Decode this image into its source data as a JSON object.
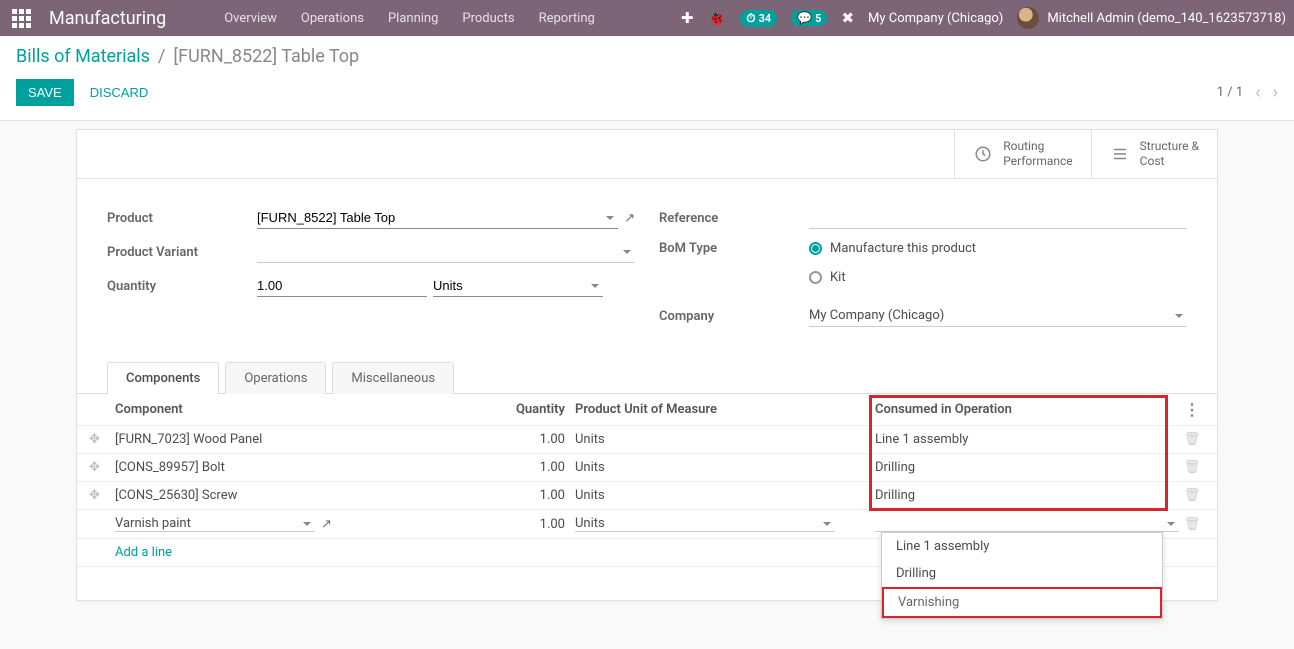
{
  "header": {
    "app": "Manufacturing",
    "nav": [
      "Overview",
      "Operations",
      "Planning",
      "Products",
      "Reporting"
    ],
    "activity_count": "34",
    "msg_count": "5",
    "company": "My Company (Chicago)",
    "user": "Mitchell Admin (demo_140_1623573718)"
  },
  "breadcrumb": {
    "parent": "Bills of Materials",
    "sep": "/",
    "current": "[FURN_8522] Table Top"
  },
  "actions": {
    "save": "SAVE",
    "discard": "DISCARD",
    "pager": "1 / 1"
  },
  "statbuttons": {
    "routing_l1": "Routing",
    "routing_l2": "Performance",
    "struct_l1": "Structure &",
    "struct_l2": "Cost"
  },
  "form": {
    "labels": {
      "product": "Product",
      "variant": "Product Variant",
      "quantity": "Quantity",
      "reference": "Reference",
      "bom_type": "BoM Type",
      "company": "Company"
    },
    "values": {
      "product": "[FURN_8522] Table Top",
      "quantity": "1.00",
      "uom": "Units",
      "bom_type_manufacture": "Manufacture this product",
      "bom_type_kit": "Kit",
      "company": "My Company (Chicago)"
    }
  },
  "tabs": {
    "components": "Components",
    "operations": "Operations",
    "misc": "Miscellaneous"
  },
  "grid": {
    "headers": {
      "component": "Component",
      "quantity": "Quantity",
      "uom": "Product Unit of Measure",
      "consumed": "Consumed in Operation"
    },
    "rows": [
      {
        "name": "[FURN_7023] Wood Panel",
        "qty": "1.00",
        "uom": "Units",
        "consumed": "Line 1 assembly"
      },
      {
        "name": "[CONS_89957] Bolt",
        "qty": "1.00",
        "uom": "Units",
        "consumed": "Drilling"
      },
      {
        "name": "[CONS_25630] Screw",
        "qty": "1.00",
        "uom": "Units",
        "consumed": "Drilling"
      }
    ],
    "editing": {
      "name": "Varnish paint",
      "qty": "1.00",
      "uom": "Units"
    },
    "add": "Add a line"
  },
  "dropdown": {
    "opts": [
      "Line 1 assembly",
      "Drilling",
      "Varnishing"
    ]
  }
}
